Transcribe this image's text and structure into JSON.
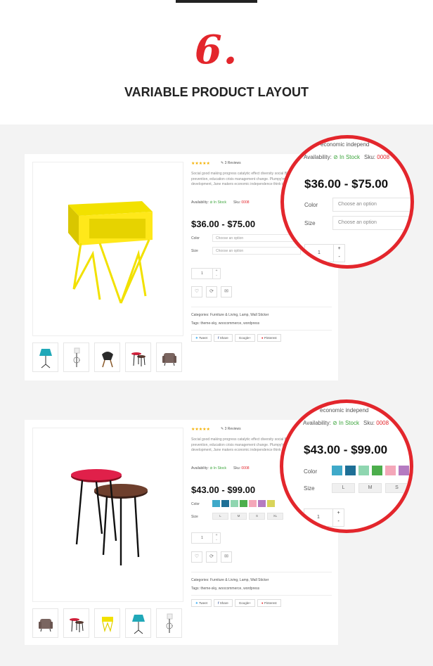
{
  "section": {
    "number": "6.",
    "title": "VARIABLE PRODUCT LAYOUT"
  },
  "product1": {
    "stars": "★★★★★",
    "reviews": "3 Reviews",
    "description": "Social good making progress catalytic effect diversity social Bloomberg. Safeguards, prevention, education crisis management change. Plumpy'nut honor planned giving development, Jane makers economic independence think tank.",
    "availability_label": "Availability:",
    "availability_value": "In Stock",
    "sku_label": "Sku:",
    "sku_value": "0008",
    "price": "$36.00 - $75.00",
    "color_label": "Color",
    "size_label": "Size",
    "color_placeholder": "Choose an option",
    "size_placeholder": "Choose an option",
    "qty": "1",
    "categories": "Categories: Furniture & Living, Lamp, Wall Sticker",
    "tags": "Tags: theme-sky, woocommerce, wordpress",
    "share": [
      "Tweet",
      "Share",
      "Google+",
      "Pinterest"
    ],
    "circle": {
      "top_text": "economic independ",
      "availability_label": "Availability:",
      "availability_value": "In Stock",
      "sku_label": "Sku:",
      "sku_value": "0008",
      "price": "$36.00 - $75.00",
      "color_label": "Color",
      "size_label": "Size",
      "color_placeholder": "Choose an option",
      "size_placeholder": "Choose an option",
      "qty": "1"
    }
  },
  "product2": {
    "stars": "★★★★★",
    "reviews": "3 Reviews",
    "description": "Social good making progress catalytic effect diversity social Bloomberg. Safeguards, prevention, education crisis management change. Plumpy'nut honor planned giving development, Jane makers economic independence think tank.",
    "availability_label": "Availability:",
    "availability_value": "In Stock",
    "sku_label": "Sku:",
    "sku_value": "0008",
    "price": "$43.00 - $99.00",
    "color_label": "Color",
    "size_label": "Size",
    "swatches": [
      "#3fa9c9",
      "#1e6f96",
      "#8fd6b0",
      "#4cae4c",
      "#f4a7b9",
      "#b57bc1",
      "#d9d45a"
    ],
    "sizes": [
      "L",
      "M",
      "S",
      "XL"
    ],
    "qty": "1",
    "categories": "Categories: Furniture & Living, Lamp, Wall Sticker",
    "tags": "Tags: theme-sky, woocommerce, wordpress",
    "share": [
      "Tweet",
      "Share",
      "Google+",
      "Pinterest"
    ],
    "circle": {
      "top_text": "economic independ",
      "availability_label": "Availability:",
      "availability_value": "In Stock",
      "sku_label": "Sku:",
      "sku_value": "0008",
      "price": "$43.00 - $99.00",
      "color_label": "Color",
      "size_label": "Size",
      "sizes": [
        "L",
        "M",
        "S"
      ],
      "qty": "1"
    }
  }
}
